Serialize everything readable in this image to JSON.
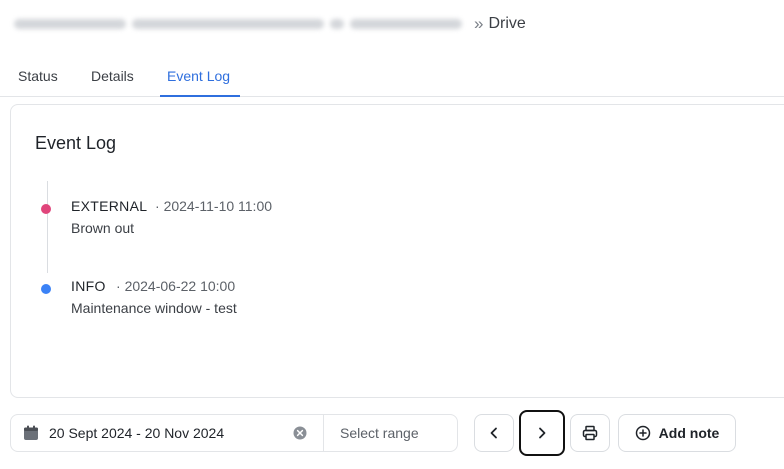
{
  "breadcrumb": {
    "separator": "»",
    "current": "Drive"
  },
  "tabs": [
    {
      "label": "Status",
      "active": false
    },
    {
      "label": "Details",
      "active": false
    },
    {
      "label": "Event Log",
      "active": true
    }
  ],
  "event_log": {
    "title": "Event Log",
    "events": [
      {
        "type": "EXTERNAL",
        "time": "2024-11-10 11:00",
        "description": "Brown out",
        "color": "#e0457b"
      },
      {
        "type": "INFO",
        "time": "2024-06-22 10:00",
        "description": "Maintenance window - test",
        "color": "#3b82f6"
      }
    ],
    "time_prefix": "·"
  },
  "toolbar": {
    "date_range": "20 Sept 2024 - 20 Nov 2024",
    "select_range_placeholder": "Select range",
    "add_note_label": "Add note",
    "icons": [
      "calendar-icon",
      "clear-icon",
      "chevron-left-icon",
      "chevron-right-icon",
      "printer-icon",
      "plus-circle-icon"
    ]
  },
  "colors": {
    "accent": "#2f6fde",
    "external_dot": "#e0457b",
    "info_dot": "#3b82f6"
  }
}
